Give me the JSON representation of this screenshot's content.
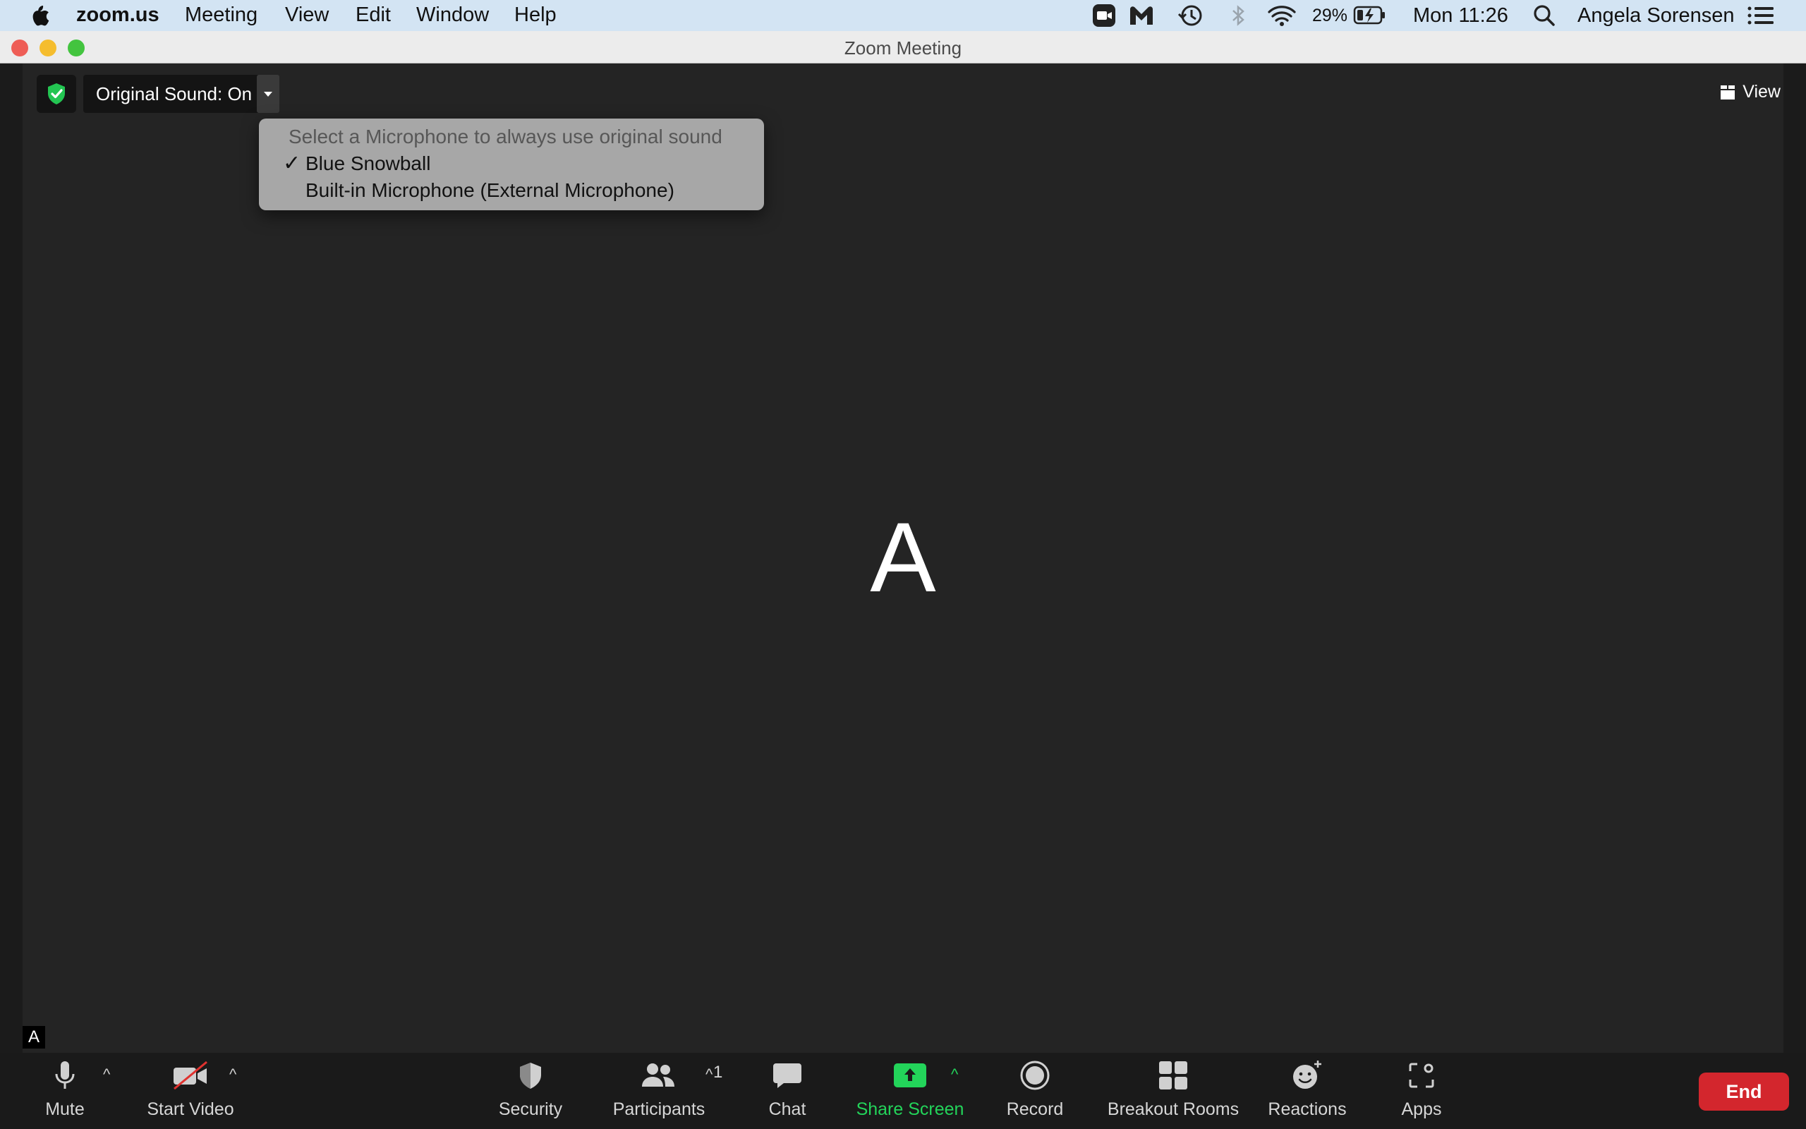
{
  "menubar": {
    "app_name": "zoom.us",
    "menus": [
      "Meeting",
      "View",
      "Edit",
      "Window",
      "Help"
    ],
    "battery": "29%",
    "clock": "Mon 11:26",
    "user": "Angela Sorensen"
  },
  "window": {
    "title": "Zoom Meeting",
    "traffic_colors": [
      "#ee5d56",
      "#f5bd2e",
      "#43c43f"
    ]
  },
  "meeting": {
    "original_sound": "Original Sound: On",
    "view_label": "View",
    "participant_initial": "A",
    "name_tag": "A"
  },
  "mic_menu": {
    "header": "Select a Microphone to always use original sound",
    "options": [
      {
        "label": "Blue Snowball",
        "checked": true
      },
      {
        "label": "Built-in Microphone (External Microphone)",
        "checked": false
      }
    ],
    "check_glyph": "✓"
  },
  "toolbar": {
    "mute": "Mute",
    "start_video": "Start Video",
    "security": "Security",
    "participants": "Participants",
    "participant_count": "1",
    "chat": "Chat",
    "share_screen": "Share Screen",
    "record": "Record",
    "breakout_rooms": "Breakout Rooms",
    "reactions": "Reactions",
    "apps": "Apps",
    "end": "End"
  },
  "colors": {
    "accent_green": "#23d45a",
    "end_red": "#d3262d",
    "shield_green": "#23c552"
  }
}
